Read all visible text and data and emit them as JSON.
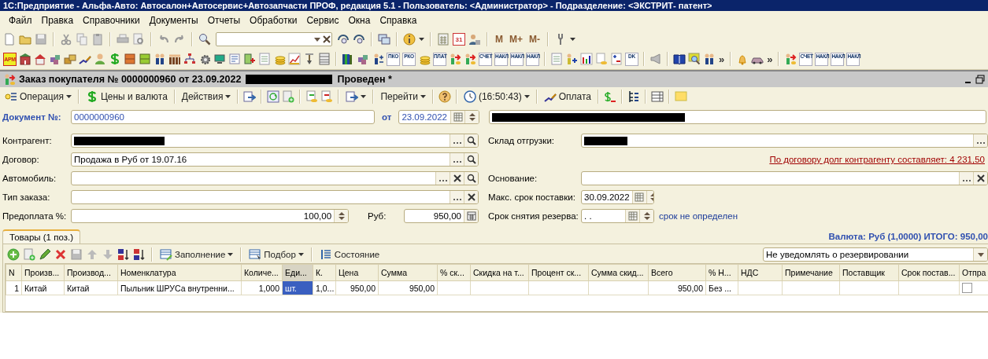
{
  "title_bar": {
    "title": "1С:Предприятие - Альфа-Авто: Автосалон+Автосервис+Автозапчасти ПРОФ, редакция 5.1 - Пользователь: <Администратор> - Подразделение: <ЭКСТРИТ- патент>"
  },
  "menu": [
    "Файл",
    "Правка",
    "Справочники",
    "Документы",
    "Отчеты",
    "Обработки",
    "Сервис",
    "Окна",
    "Справка"
  ],
  "main_toolbar": {
    "calendar_day": "31",
    "memory_buttons": [
      "M",
      "M+",
      "M-"
    ]
  },
  "quick_toolbar": {
    "icon_labels": [
      "АРМ",
      "ПКО",
      "РКО",
      "ПЛАТ",
      "СЧЕТ",
      "НАКЛ",
      "НАКЛ",
      "НАКЛ",
      "DK",
      "СЧЕТ",
      "НАКЛ",
      "НАКЛ",
      "НАКЛ"
    ],
    "more": [
      "»",
      "»"
    ]
  },
  "document": {
    "title": "Заказ покупателя № 0000000960 от 23.09.2022",
    "status": "Проведен *",
    "toolbar": {
      "operation": "Операция",
      "prices": "Цены и валюта",
      "actions": "Действия",
      "goto": "Перейти",
      "time": "(16:50:43)",
      "payment": "Оплата"
    },
    "number_label": "Документ №:",
    "number": "0000000960",
    "date_label": "от",
    "date": "23.09.2022",
    "left_fields": [
      {
        "label": "Контрагент:",
        "redacted": true,
        "buttons": [
          {
            "kind": "choose"
          },
          {
            "kind": "search"
          }
        ]
      },
      {
        "label": "Договор:",
        "value": "Продажа в Руб от 19.07.16",
        "buttons": [
          {
            "kind": "choose"
          },
          {
            "kind": "search"
          }
        ]
      },
      {
        "label": "Автомобиль:",
        "buttons": [
          {
            "kind": "choose"
          },
          {
            "kind": "clear"
          },
          {
            "kind": "search"
          }
        ]
      },
      {
        "label": "Тип заказа:",
        "buttons": [
          {
            "kind": "choose"
          },
          {
            "kind": "clear"
          }
        ]
      },
      {
        "label": "Предоплата %:",
        "value": "100,00",
        "buttons": [
          {
            "kind": "spin"
          }
        ]
      }
    ],
    "amount_label": "Руб:",
    "amount": "950,00",
    "right_rows": [
      {
        "kind": "field",
        "label": "Склад отгрузки:",
        "redacted": true,
        "buttons": [
          {
            "kind": "choose"
          }
        ]
      },
      {
        "kind": "link",
        "text": "По договору долг контрагенту составляет: 4 231,50"
      },
      {
        "kind": "field",
        "label": "Основание:",
        "buttons": [
          {
            "kind": "choose"
          },
          {
            "kind": "clear"
          }
        ]
      },
      {
        "kind": "date",
        "label": "Макс. срок поставки:",
        "value": "30.09.2022"
      },
      {
        "kind": "date",
        "label": "Срок снятия резерва:",
        "value": ". .",
        "note": "срок не определен"
      }
    ],
    "tabs": [
      {
        "label": "Товары (1 поз.)",
        "selected": true
      }
    ],
    "total": "Валюта: Руб (1,0000) ИТОГО: 950,00",
    "tab_toolbar": {
      "fill": "Заполнение",
      "pick": "Подбор",
      "state": "Состояние",
      "notify": "Не уведомлять о резервировании"
    },
    "table": {
      "columns": [
        {
          "label": "N",
          "selected": false
        },
        {
          "label": "Произв...",
          "selected": false
        },
        {
          "label": "Производ...",
          "selected": false
        },
        {
          "label": "Номенклатура",
          "selected": false
        },
        {
          "label": "Количе...",
          "selected": false
        },
        {
          "label": "Еди...",
          "selected": true
        },
        {
          "label": "К.",
          "selected": false
        },
        {
          "label": "Цена",
          "selected": false
        },
        {
          "label": "Сумма",
          "selected": false
        },
        {
          "label": "% ск...",
          "selected": false
        },
        {
          "label": "Скидка на т...",
          "selected": false
        },
        {
          "label": "Процент ск...",
          "selected": false
        },
        {
          "label": "Сумма скид...",
          "selected": false
        },
        {
          "label": "Всего",
          "selected": false
        },
        {
          "label": "% Н...",
          "selected": false
        },
        {
          "label": "НДС",
          "selected": false
        },
        {
          "label": "Примечание",
          "selected": false
        },
        {
          "label": "Поставщик",
          "selected": false
        },
        {
          "label": "Срок постав...",
          "selected": false
        },
        {
          "label": "Отпра",
          "selected": false
        }
      ],
      "rows": [
        {
          "cells": [
            {
              "kind": "text",
              "text": "1",
              "selected": false
            },
            {
              "kind": "text",
              "text": "Китай",
              "selected": false
            },
            {
              "kind": "text",
              "text": "Китай",
              "selected": false
            },
            {
              "kind": "text",
              "text": "Пыльник ШРУСа внутренни...",
              "selected": false
            },
            {
              "kind": "text",
              "text": "1,000",
              "selected": false
            },
            {
              "kind": "text",
              "text": "шт.",
              "selected": true
            },
            {
              "kind": "text",
              "text": "1,0...",
              "selected": false
            },
            {
              "kind": "text",
              "text": "950,00",
              "selected": false
            },
            {
              "kind": "text",
              "text": "950,00",
              "selected": false
            },
            {
              "kind": "text",
              "selected": false
            },
            {
              "kind": "text",
              "selected": false
            },
            {
              "kind": "text",
              "selected": false
            },
            {
              "kind": "text",
              "selected": false
            },
            {
              "kind": "text",
              "text": "950,00",
              "selected": false
            },
            {
              "kind": "text",
              "text": "Без ...",
              "selected": false
            },
            {
              "kind": "text",
              "selected": false
            },
            {
              "kind": "text",
              "selected": false
            },
            {
              "kind": "text",
              "selected": false
            },
            {
              "kind": "text",
              "selected": false
            },
            {
              "kind": "checkbox",
              "checked": false,
              "selected": false
            }
          ]
        }
      ]
    }
  }
}
